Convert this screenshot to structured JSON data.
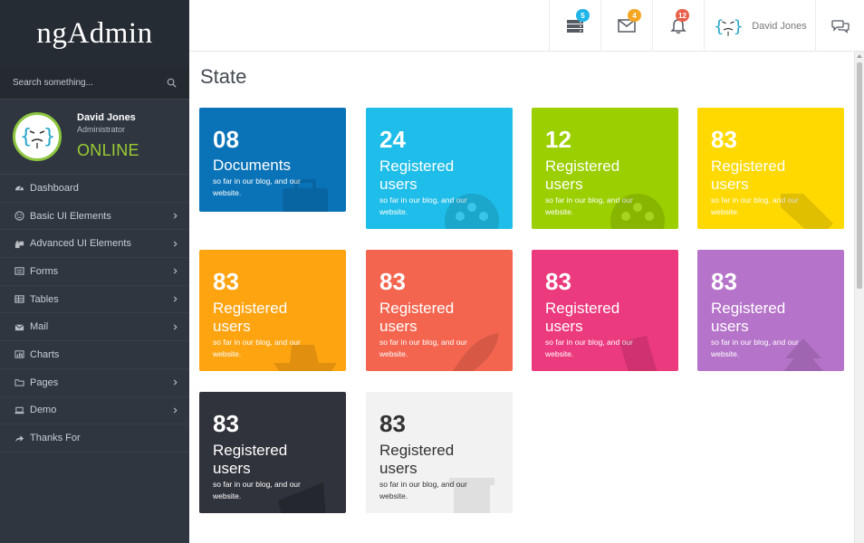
{
  "brand": "ngAdmin",
  "search": {
    "placeholder": "Search something..."
  },
  "profile": {
    "name": "David Jones",
    "role": "Administrator",
    "status": "ONLINE"
  },
  "menu": [
    {
      "label": "Dashboard",
      "icon": "dashboard-icon",
      "submenu": false
    },
    {
      "label": "Basic UI Elements",
      "icon": "smile-icon",
      "submenu": true
    },
    {
      "label": "Advanced UI Elements",
      "icon": "puzzle-icon",
      "submenu": true
    },
    {
      "label": "Forms",
      "icon": "list-icon",
      "submenu": true
    },
    {
      "label": "Tables",
      "icon": "table-icon",
      "submenu": true
    },
    {
      "label": "Mail",
      "icon": "mail-icon",
      "submenu": true
    },
    {
      "label": "Charts",
      "icon": "bar-chart-icon",
      "submenu": false
    },
    {
      "label": "Pages",
      "icon": "folder-icon",
      "submenu": true
    },
    {
      "label": "Demo",
      "icon": "laptop-icon",
      "submenu": true
    },
    {
      "label": "Thanks For",
      "icon": "share-icon",
      "submenu": false
    }
  ],
  "topbar": {
    "tasks_badge": "5",
    "messages_badge": "4",
    "notifications_badge": "12",
    "user_name": "David Jones",
    "colors": {
      "tasks": "#1fb5e8",
      "messages": "#f5a623",
      "notifications": "#e8604c"
    }
  },
  "page": {
    "title": "State"
  },
  "tiles": [
    {
      "number": "08",
      "title": "Documents",
      "subtitle": "so far in our blog, and our website.",
      "color": "#0a73b8",
      "icon": "briefcase-icon"
    },
    {
      "number": "24",
      "title": "Registered users",
      "subtitle": "so far in our blog, and our website.",
      "color": "#1fbde9",
      "icon": "film-reel-icon"
    },
    {
      "number": "12",
      "title": "Registered users",
      "subtitle": "so far in our blog, and our website.",
      "color": "#9bcf00",
      "icon": "film-reel-icon"
    },
    {
      "number": "83",
      "title": "Registered users",
      "subtitle": "so far in our blog, and our website.",
      "color": "#ffd900",
      "icon": "tag-icon"
    },
    {
      "number": "83",
      "title": "Registered users",
      "subtitle": "so far in our blog, and our website.",
      "color": "#ffa411",
      "icon": "ship-icon"
    },
    {
      "number": "83",
      "title": "Registered users",
      "subtitle": "so far in our blog, and our website.",
      "color": "#f4654f",
      "icon": "rocket-icon"
    },
    {
      "number": "83",
      "title": "Registered users",
      "subtitle": "so far in our blog, and our website.",
      "color": "#ec3a7f",
      "icon": "book-icon"
    },
    {
      "number": "83",
      "title": "Registered users",
      "subtitle": "so far in our blog, and our website.",
      "color": "#b573c9",
      "icon": "tree-icon"
    },
    {
      "number": "83",
      "title": "Registered users",
      "subtitle": "so far in our blog, and our website.",
      "color": "#30333c",
      "icon": "cap-icon"
    },
    {
      "number": "83",
      "title": "Registered users",
      "subtitle": "so far in our blog, and our website.",
      "color": "#f2f2f2",
      "icon": "mug-icon"
    }
  ]
}
